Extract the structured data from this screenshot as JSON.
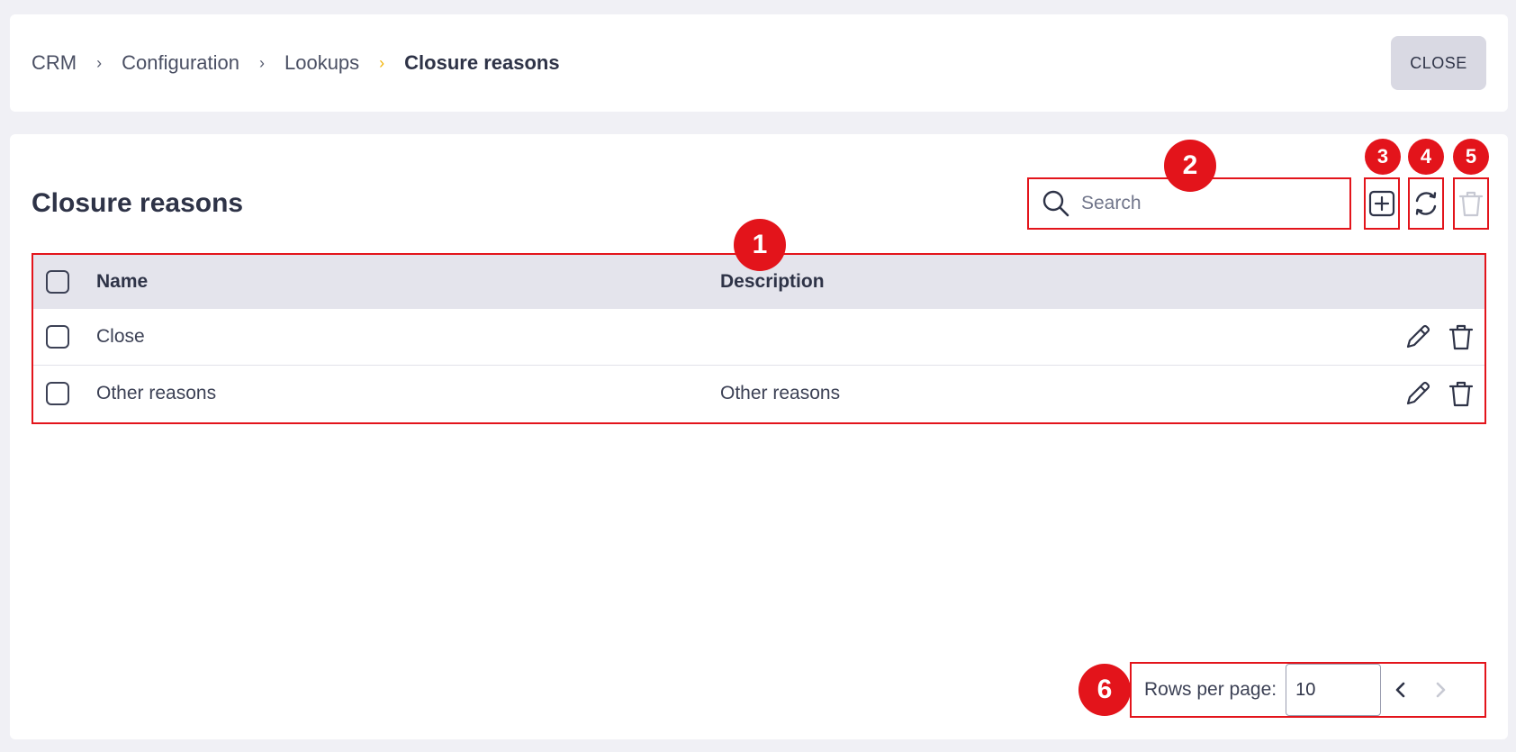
{
  "breadcrumb": [
    "CRM",
    "Configuration",
    "Lookups",
    "Closure reasons"
  ],
  "close_label": "CLOSE",
  "page_title": "Closure reasons",
  "search": {
    "placeholder": "Search"
  },
  "table": {
    "columns": [
      "Name",
      "Description"
    ],
    "rows": [
      {
        "name": "Close",
        "description": ""
      },
      {
        "name": "Other reasons",
        "description": "Other reasons"
      }
    ]
  },
  "pagination": {
    "rows_per_page_label": "Rows per page:",
    "rows_per_page": "10"
  },
  "annotations": [
    "1",
    "2",
    "3",
    "4",
    "5",
    "6"
  ],
  "colors": {
    "annotation": "#e3141b",
    "breadcrumb_separator_accent": "#f2b40a",
    "header_bg": "#e4e4ec"
  }
}
